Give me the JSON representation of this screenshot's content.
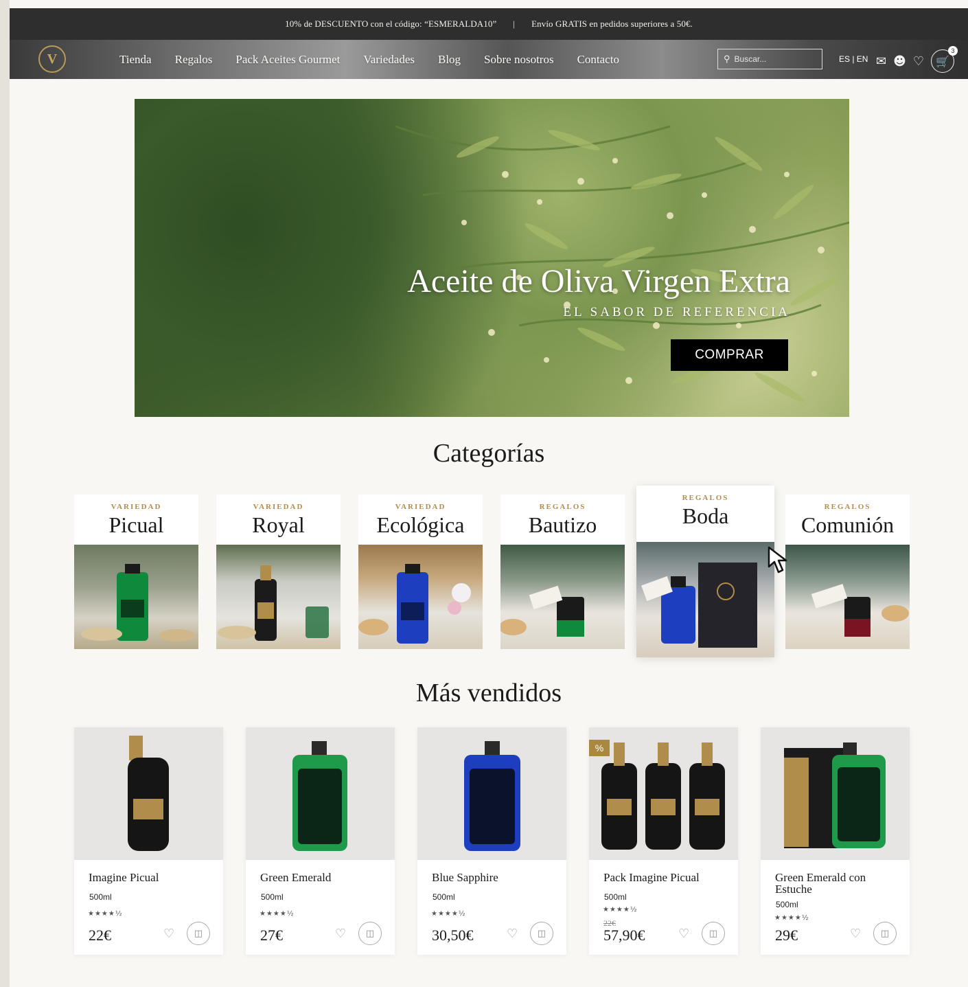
{
  "promo": {
    "discount": "10% de DESCUENTO con el código: “ESMERALDA10”",
    "separator": "|",
    "shipping": "Envío GRATIS en pedidos superiores a 50€."
  },
  "nav": {
    "items": [
      "Tienda",
      "Regalos",
      "Pack Aceites Gourmet",
      "Variedades",
      "Blog",
      "Sobre nosotros",
      "Contacto"
    ],
    "search_placeholder": "Buscar...",
    "lang": "ES | EN",
    "cart_count": "3"
  },
  "hero": {
    "title": "Aceite de Oliva Virgen Extra",
    "subtitle": "EL SABOR DE REFERENCIA",
    "cta": "COMPRAR"
  },
  "categories": {
    "title": "Categorías",
    "items": [
      {
        "kicker": "VARIEDAD",
        "name": "Picual"
      },
      {
        "kicker": "VARIEDAD",
        "name": "Royal"
      },
      {
        "kicker": "VARIEDAD",
        "name": "Ecológica"
      },
      {
        "kicker": "REGALOS",
        "name": "Bautizo"
      },
      {
        "kicker": "REGALOS",
        "name": "Boda"
      },
      {
        "kicker": "REGALOS",
        "name": "Comunión"
      }
    ]
  },
  "bestsellers": {
    "title": "Más vendidos",
    "products": [
      {
        "name": "Imagine Picual",
        "volume": "500ml",
        "rating": 4.5,
        "price": "22€",
        "old_price": ""
      },
      {
        "name": "Green Emerald",
        "volume": "500ml",
        "rating": 4.5,
        "price": "27€",
        "old_price": ""
      },
      {
        "name": "Blue Sapphire",
        "volume": "500ml",
        "rating": 4.5,
        "price": "30,50€",
        "old_price": ""
      },
      {
        "name": "Pack Imagine Picual",
        "volume": "500ml",
        "rating": 4.5,
        "price": "57,90€",
        "old_price": "22€",
        "tag": "%"
      },
      {
        "name": "Green Emerald con Estuche",
        "volume": "500ml",
        "rating": 4.5,
        "price": "29€",
        "old_price": ""
      }
    ]
  },
  "colors": {
    "gold": "#b08d4a",
    "dark": "#2e2e2e",
    "emerald": "#1f9a4b",
    "sapphire": "#1d3fbf"
  }
}
